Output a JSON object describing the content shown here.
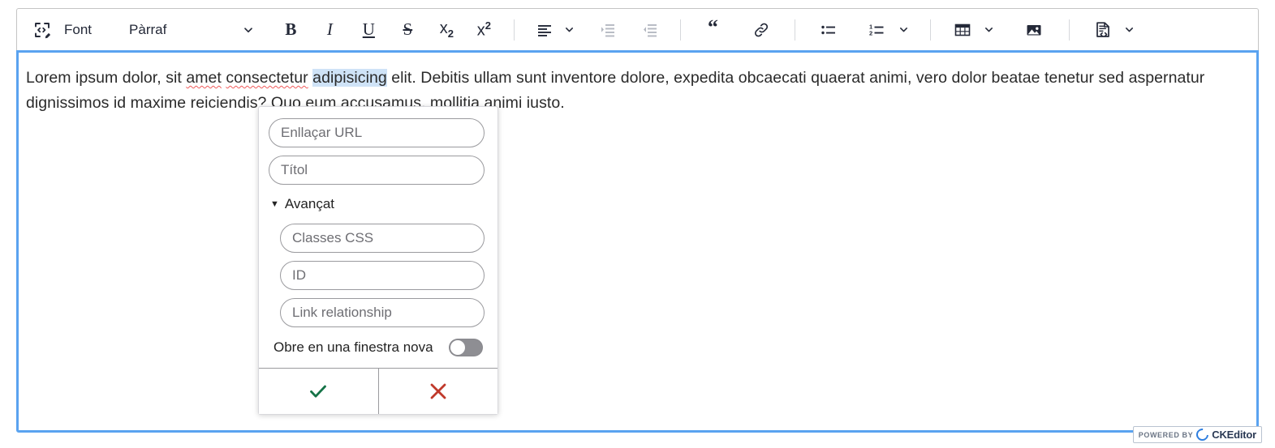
{
  "toolbar": {
    "source_icon": "source-editing-icon",
    "font_label": "Font",
    "paragraph_dropdown": {
      "value": "Pàrraf",
      "caret": "chevron-down-icon"
    },
    "buttons": [
      {
        "name": "bold",
        "glyph": "B"
      },
      {
        "name": "italic",
        "glyph": "I"
      },
      {
        "name": "underline",
        "glyph": "U"
      },
      {
        "name": "strikethrough",
        "glyph": "S"
      },
      {
        "name": "subscript",
        "glyph": "x",
        "script": "2"
      },
      {
        "name": "superscript",
        "glyph": "x",
        "script": "2"
      },
      {
        "name": "alignment",
        "glyph": "align-left-icon"
      },
      {
        "name": "indent",
        "glyph": "indent-icon",
        "disabled": true
      },
      {
        "name": "outdent",
        "glyph": "outdent-icon",
        "disabled": true
      },
      {
        "name": "blockquote",
        "glyph": "“"
      },
      {
        "name": "link",
        "glyph": "link-icon"
      },
      {
        "name": "bulleted-list",
        "glyph": "bulleted-list-icon"
      },
      {
        "name": "numbered-list",
        "glyph": "numbered-list-icon"
      },
      {
        "name": "insert-table",
        "glyph": "table-icon"
      },
      {
        "name": "insert-image",
        "glyph": "image-icon"
      },
      {
        "name": "html-embed",
        "glyph": "html-embed-icon"
      }
    ]
  },
  "document": {
    "line1_part1": "Lorem ipsum dolor, sit ",
    "line1_spell1": "amet",
    "line1_part2": " ",
    "line1_spell2": "consectetur",
    "line1_part3": " ",
    "line1_selected": "adipisicing",
    "line1_part4": " elit. Debitis ullam sunt inventore dolore, expedita obcaecati quaerat animi, vero dolor beatae tenetur sed ",
    "line2": "aspernatur dignissimos id maxime reiciendis? Quo eum accusamus, mollitia animi iusto."
  },
  "link_balloon": {
    "url_placeholder": "Enllaçar URL",
    "url_value": "",
    "title_placeholder": "Títol",
    "title_value": "",
    "advanced_label": "Avançat",
    "advanced_caret": "▼",
    "advanced_expanded": true,
    "css_classes_placeholder": "Classes CSS",
    "css_classes_value": "",
    "id_placeholder": "ID",
    "id_value": "",
    "rel_placeholder": "Link relationship",
    "rel_value": "",
    "new_window_label": "Obre en una finestra nova",
    "new_window_on": false,
    "save_icon": "check-icon",
    "save_color": "#157347",
    "cancel_icon": "x-icon",
    "cancel_color": "#c0392b"
  },
  "branding": {
    "powered_by": "POWERED BY",
    "brand": "CKEditor",
    "mark": "ckeditor-logo-icon"
  },
  "colors": {
    "focus_border": "#5aa3f0",
    "toolbar_border": "#c4c4c4",
    "selection_highlight": "#cfe3f7",
    "spellcheck_underline": "#f05a5a",
    "toggle_off_track": "#8e8e93"
  }
}
